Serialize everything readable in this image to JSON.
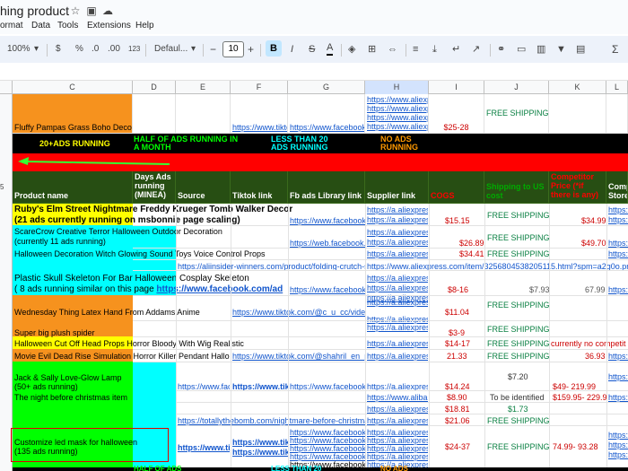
{
  "app": {
    "title": "hing product",
    "menu": [
      "ormat",
      "Data",
      "Tools",
      "Extensions",
      "Help"
    ]
  },
  "toolbar": {
    "zoom": "100%",
    "currency": "$",
    "percent": "%",
    "dec_less": ".0",
    "dec_more": ".00",
    "format_123": "123",
    "font": "Defaul...",
    "font_size": "10",
    "bold": "B",
    "italic": "I",
    "strike": "S",
    "text_color": "A",
    "sigma": "Σ",
    "minus": "−",
    "plus": "+"
  },
  "columns": [
    "C",
    "D",
    "E",
    "F",
    "G",
    "H",
    "I",
    "J",
    "K",
    "L"
  ],
  "row_numbers": [
    "5"
  ],
  "rows": {
    "fluffy": {
      "name": "Fluffy Pampas Grass Boho Decor Flower",
      "tiktok": "https://www.tiktok",
      "fb": "https://www.facebook.",
      "supplier": [
        "https://www.aliexp",
        "https://www.aliexp",
        "https://www.aliexp",
        "https://www.aliexp"
      ],
      "cogs": "$25-28",
      "shipping": "FREE SHIPPING"
    },
    "legend": {
      "a": "20+ADS RUNNING",
      "b": "HALF OF ADS RUNNING IN A MONTH",
      "c": "LESS THAN 20 ADS RUNNING",
      "d": "NO ADS RUNNING"
    },
    "header": {
      "row_label": "5",
      "product": "Product name",
      "days": "Days Ads running (MINEA)",
      "source": "Source",
      "tiktok": "Tiktok link",
      "fb": "Fb ads Library link",
      "supplier": "Supplier link",
      "cogs": "COGS",
      "shipping": "Shipping to US cost",
      "competitor": "Competitor Price (*if there is any)",
      "comp_store": "Comp Store"
    },
    "items": [
      {
        "name": "Ruby's Elm Street Nightmare Freddy Krueger Tomb Walker Decor Pr",
        "sub": "(21 ads currently running on msbonnie page scaling)",
        "fb": "https://www.facebook.",
        "supplier": [
          "https://a.aliexpress",
          "https://a.aliexpress"
        ],
        "cogs": "$15.15",
        "shipping": "FREE SHIPPING",
        "competitor": "$34.99",
        "store": [
          "https:",
          "https:"
        ]
      },
      {
        "name": "ScareCrow Creative Terror Halloween Outdoor Decoration",
        "sub": "(currently 11 ads running)",
        "fb": "https://web.facebook.c",
        "supplier": [
          "https://a.aliexpress",
          "https://a.aliexpress"
        ],
        "cogs": "$26.89",
        "shipping": "FREE SHIPPING",
        "competitor": "$49.70",
        "store": [
          "https:"
        ]
      },
      {
        "name": "Halloween Decoration Witch Glowing Sound Toys Voice Control Props",
        "supplier": [
          "https://a.aliexpress"
        ],
        "cogs": "$34.41",
        "shipping": "FREE SHIPPING",
        "store": [
          "https:"
        ]
      },
      {
        "long_link": "https://aliinsider-winners.com/product/folding-crutch-sto",
        "supplier": "https://www.aliexpress.com/item/3256804538205115.html?spm=a2g0o.pr"
      },
      {
        "name": "Plastic Skull Skeleton For Bar Halloween Cosplay Skeleton",
        "sub": "( 8 ads running similar on this page ",
        "link": "https://www.facebook.com/ad",
        "fb": "https://www.facebook.",
        "supplier": [
          "https://a.aliexpress",
          "https://a.aliexpress",
          "https://a.aliexpress"
        ],
        "cogs": "$8-16",
        "shipping": "$7.93",
        "competitor": "67.99",
        "store": [
          "https:"
        ]
      },
      {
        "name": "Wednesday Thing Latex Hand From Addams Anime",
        "tiktok": "https://www.tiktok.com/@c_u_cc/video/",
        "supplier": [
          "https://a.aliexpress",
          "https://a.aliexpress"
        ],
        "cogs": "$11.04",
        "shipping": "FREE SHIPPING"
      },
      {
        "name": "Super big plush spider",
        "supplier": [
          "https://a.aliexpress"
        ],
        "cogs": "$3-9",
        "shipping": "FREE SHIPPING"
      },
      {
        "name": "Halloween Cut Off Head Props Horror Bloody With Wig Realistic",
        "supplier": [
          "https://a.aliexpress"
        ],
        "cogs": "$14-17",
        "shipping": "FREE SHIPPING",
        "competitor": "currently no competit"
      },
      {
        "name": "Movie Evil Dead Rise Simulation Horror Killer Pendant Hallo",
        "tiktok": "https://www.tiktok.com/@shahril_en_pe",
        "supplier": [
          "https://a.aliexpress"
        ],
        "cogs": "21.33",
        "shipping": "FREE SHIPPING",
        "competitor": "36.93",
        "store": [
          "https:"
        ]
      },
      {
        "name": "Jack & Sally Love-Glow Lamp",
        "sub": "(50+ ads running)",
        "source": "https://www.face",
        "tiktok": "https://www.tikt",
        "fb": "https://www.facebook.",
        "supplier": [
          "https://a.aliexpress"
        ],
        "cogs": "$14.24",
        "shipping": "$7.20",
        "competitor": "$49- 219.99",
        "store": [
          "https:"
        ]
      },
      {
        "name": "The night before christmas item",
        "supplier": [
          "https://www.alibab"
        ],
        "cogs": "$8.90",
        "shipping": "To be identified",
        "competitor": "$159.95- 229.94",
        "store": [
          "https:"
        ]
      },
      {
        "supplier": [
          "https://a.aliexpress"
        ],
        "cogs": "$18.81",
        "shipping": "$1.73"
      },
      {
        "long_link": "https://totallythebomb.com/nightmare-before-christmas-",
        "supplier": [
          "https://a.aliexpress"
        ],
        "cogs": "$21.06",
        "shipping": "FREE SHIPPING"
      },
      {
        "name": "Customize led mask for halloween",
        "sub": "(135 ads running)",
        "source": "https://www.tikt",
        "tiktok": "https://www.tikt",
        "fb": [
          "https://www.facebook.",
          "https://www.facebook.",
          "https://www.facebook.",
          "https://www.facebook.",
          "https://www.facebook."
        ],
        "supplier": [
          "https://a.aliexpress",
          "https://a.aliexpress",
          "https://a.aliexpress",
          "https://a.aliexpress",
          "https://a.aliexpress"
        ],
        "cogs": "$24-37",
        "shipping": "FREE SHIPPING",
        "competitor": "74.99- 93.28",
        "store": [
          "https:",
          "https:",
          "https:"
        ]
      }
    ],
    "bottom_legend": {
      "a": "HALF OF ADS",
      "b": "LESS THAN 20",
      "c": "NO ADS"
    }
  },
  "colors": {
    "accent": "#1a73e8",
    "link": "#1155cc",
    "red": "#cc0000",
    "green": "#0b8043",
    "orange": "#f6921e",
    "lime": "#00ff00",
    "cyan": "#00ffff"
  }
}
